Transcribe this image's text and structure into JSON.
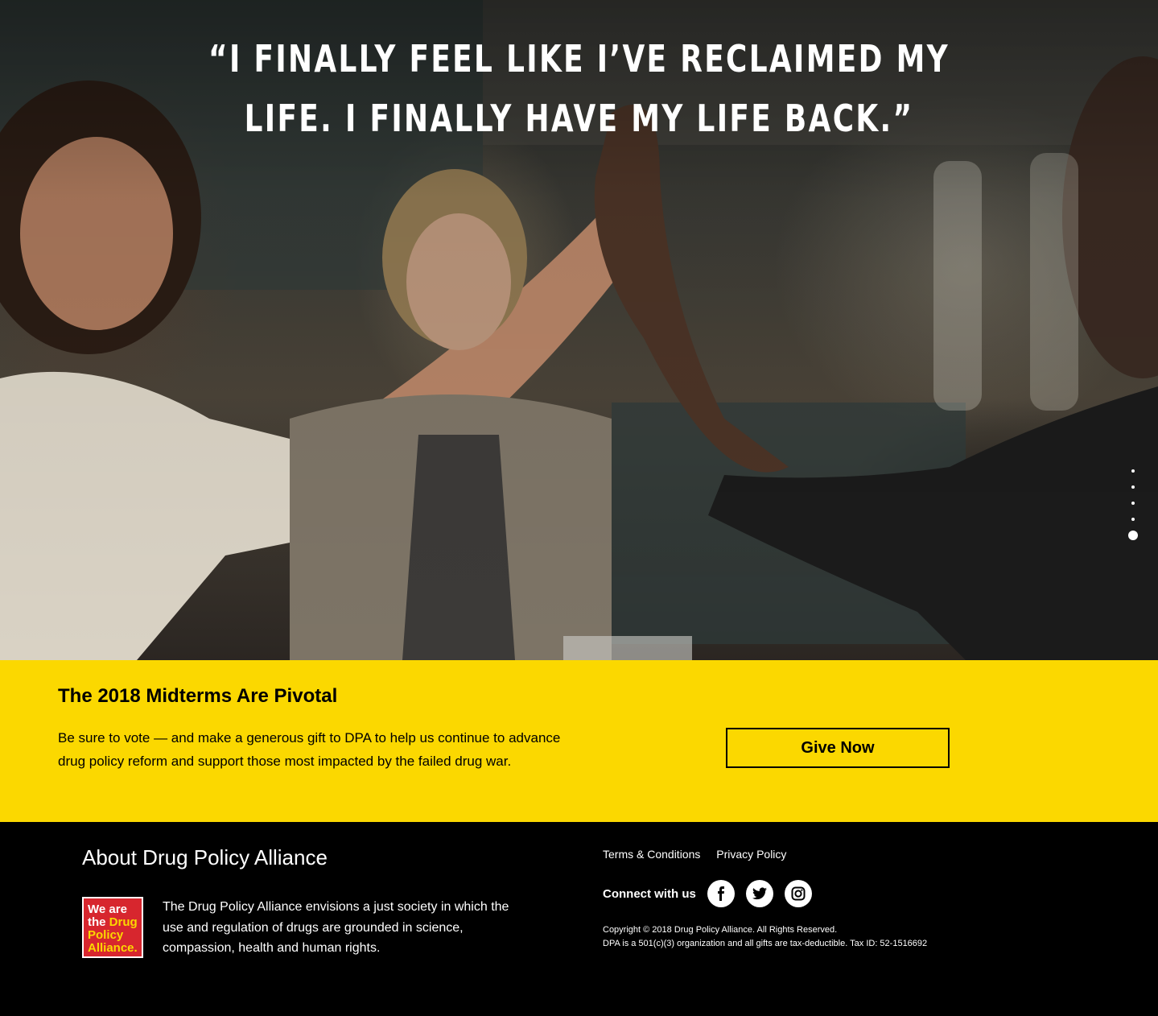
{
  "hero": {
    "quote": "“I FINALLY FEEL LIKE I’VE RECLAIMED MY LIFE. I FINALLY HAVE MY LIFE BACK.”",
    "slide_count": 5,
    "active_slide": 5
  },
  "cta": {
    "title": "The 2018 Midterms Are Pivotal",
    "body": "Be sure to vote — and make a generous gift to DPA to help us continue to advance drug policy reform and support those most impacted by the failed drug war.",
    "button_label": "Give Now",
    "background_color": "#fbd800"
  },
  "footer": {
    "about_title": "About Drug Policy Alliance",
    "logo": {
      "line1": "We are",
      "line2a": "the ",
      "line2b": "Drug",
      "line3": "Policy",
      "line4": "Alliance."
    },
    "about_text": "The Drug Policy Alliance envisions a just society in which the use and regulation of drugs are grounded in science, compassion, health and human rights.",
    "links": [
      "Terms & Conditions",
      "Privacy Policy"
    ],
    "connect_label": "Connect with us",
    "social": [
      "facebook-icon",
      "twitter-icon",
      "instagram-icon"
    ],
    "copyright_line1": "Copyright © 2018 Drug Policy Alliance. All Rights Reserved.",
    "copyright_line2": "DPA is a 501(c)(3) organization and all gifts are tax-deductible. Tax ID: 52-1516692"
  }
}
